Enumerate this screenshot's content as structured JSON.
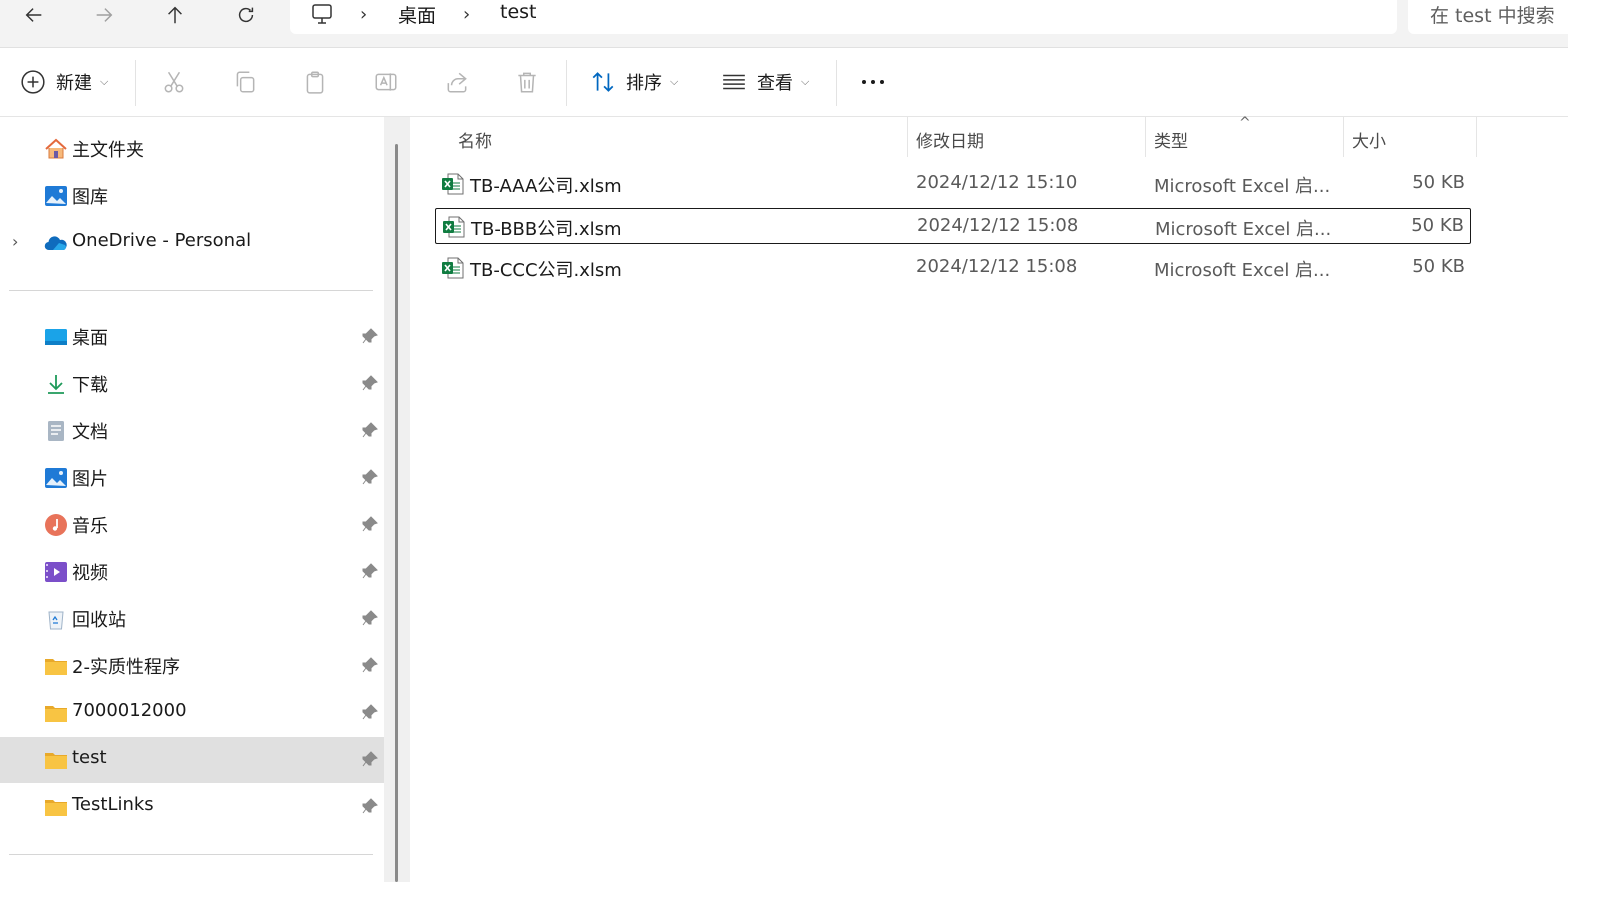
{
  "address": {
    "crumbs": [
      "桌面",
      "test"
    ],
    "search_placeholder": "在 test 中搜索"
  },
  "toolbar": {
    "new_label": "新建",
    "sort_label": "排序",
    "view_label": "查看"
  },
  "sidebar": {
    "top_items": [
      {
        "label": "主文件夹",
        "icon": "home-icon"
      },
      {
        "label": "图库",
        "icon": "gallery-icon"
      },
      {
        "label": "OneDrive - Personal",
        "icon": "onedrive-icon"
      }
    ],
    "quick_items": [
      {
        "label": "桌面",
        "icon": "desktop-icon"
      },
      {
        "label": "下载",
        "icon": "download-icon"
      },
      {
        "label": "文档",
        "icon": "document-icon"
      },
      {
        "label": "图片",
        "icon": "pictures-icon"
      },
      {
        "label": "音乐",
        "icon": "music-icon"
      },
      {
        "label": "视频",
        "icon": "video-icon"
      },
      {
        "label": "回收站",
        "icon": "recycle-bin-icon"
      },
      {
        "label": "2-实质性程序",
        "icon": "folder-icon"
      },
      {
        "label": "7000012000",
        "icon": "folder-icon"
      },
      {
        "label": "test",
        "icon": "folder-icon",
        "active": true
      },
      {
        "label": "TestLinks",
        "icon": "folder-icon"
      }
    ]
  },
  "columns": {
    "name": "名称",
    "date": "修改日期",
    "type": "类型",
    "size": "大小"
  },
  "files": [
    {
      "name": "TB-AAA公司.xlsm",
      "date": "2024/12/12 15:10",
      "type": "Microsoft Excel 启...",
      "size": "50 KB",
      "selected": false
    },
    {
      "name": "TB-BBB公司.xlsm",
      "date": "2024/12/12 15:08",
      "type": "Microsoft Excel 启...",
      "size": "50 KB",
      "selected": true
    },
    {
      "name": "TB-CCC公司.xlsm",
      "date": "2024/12/12 15:08",
      "type": "Microsoft Excel 启...",
      "size": "50 KB",
      "selected": false
    }
  ],
  "colors": {
    "accent": "#0067c0",
    "excel_green": "#107c41",
    "folder_yellow": "#f8c443",
    "active_bg": "#e0e0e0"
  }
}
